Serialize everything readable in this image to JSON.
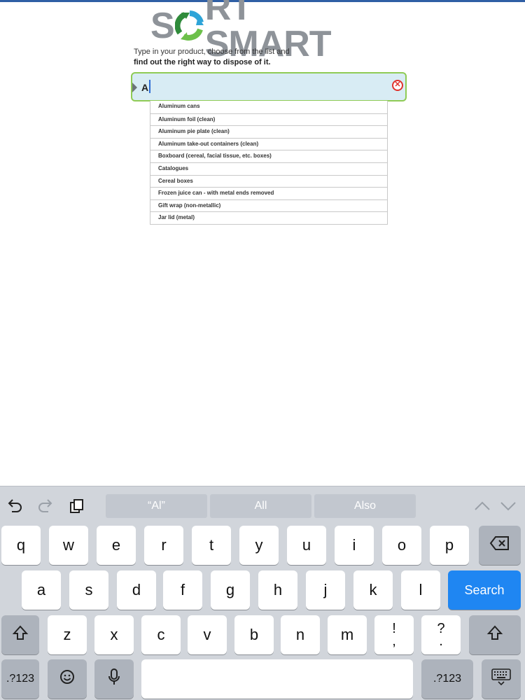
{
  "app": {
    "logo_text_left": "S",
    "logo_text_right": "RT SMART"
  },
  "intro": {
    "line1": "Type in your product, choose from the list and",
    "line2": "find out the right way to dispose of it."
  },
  "search": {
    "value": "Al"
  },
  "suggestions": [
    "Aluminum cans",
    "Aluminum foil (clean)",
    "Aluminum pie plate (clean)",
    "Aluminum take-out containers (clean)",
    "Boxboard (cereal, facial tissue, etc. boxes)",
    "Catalogues",
    "Cereal boxes",
    "Frozen juice can - with metal ends removed",
    "Gift wrap (non-metallic)",
    "Jar lid (metal)"
  ],
  "keyboard": {
    "predictions": [
      "“Al”",
      "All",
      "Also"
    ],
    "row1": [
      "q",
      "w",
      "e",
      "r",
      "t",
      "y",
      "u",
      "i",
      "o",
      "p"
    ],
    "row2": [
      "a",
      "s",
      "d",
      "f",
      "g",
      "h",
      "j",
      "k",
      "l"
    ],
    "row3": [
      "z",
      "x",
      "c",
      "v",
      "b",
      "n",
      "m"
    ],
    "punct1_top": "!",
    "punct1_bottom": ",",
    "punct2_top": "?",
    "punct2_bottom": ".",
    "search_label": "Search",
    "numbers_left": ".?123",
    "numbers_right": ".?123"
  },
  "icons": {
    "undo": "undo-icon",
    "redo": "redo-icon",
    "paste": "paste-icon",
    "up": "chevron-up-icon",
    "down": "chevron-down-icon",
    "delete": "backspace-icon",
    "shift": "shift-icon",
    "emoji": "emoji-icon",
    "mic": "microphone-icon",
    "hide": "keyboard-hide-icon"
  },
  "colors": {
    "accent_green": "#8fcb55",
    "search_bg": "#d8ecf4",
    "clear_red": "#e0332d",
    "search_key_blue": "#1f86f2",
    "logo_gray": "#8e9399"
  }
}
